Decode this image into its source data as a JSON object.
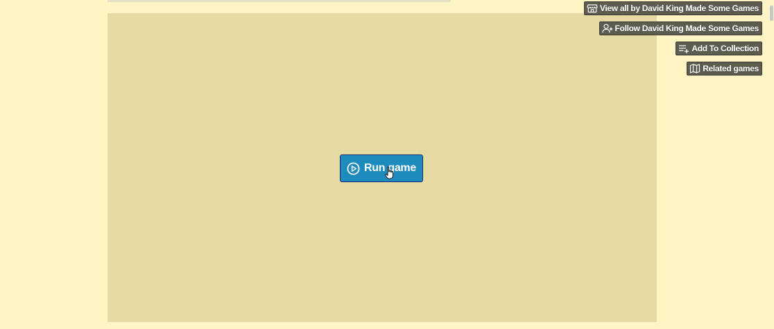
{
  "game": {
    "run_button_label": "Run game",
    "run_button_icon": "play-circle-icon"
  },
  "side_actions": {
    "view_all_label": "View all by David King Made Some Games",
    "view_all_icon": "storefront-icon",
    "follow_label": "Follow David King Made Some Games",
    "follow_icon": "user-plus-icon",
    "add_collection_label": "Add To Collection",
    "add_collection_icon": "playlist-add-icon",
    "related_label": "Related games",
    "related_icon": "map-icon"
  },
  "colors": {
    "page_background": "#fff4c4",
    "game_frame_background": "#e5d9a4",
    "run_button": "#1e8bbd",
    "side_button": "#5e5b4f"
  }
}
